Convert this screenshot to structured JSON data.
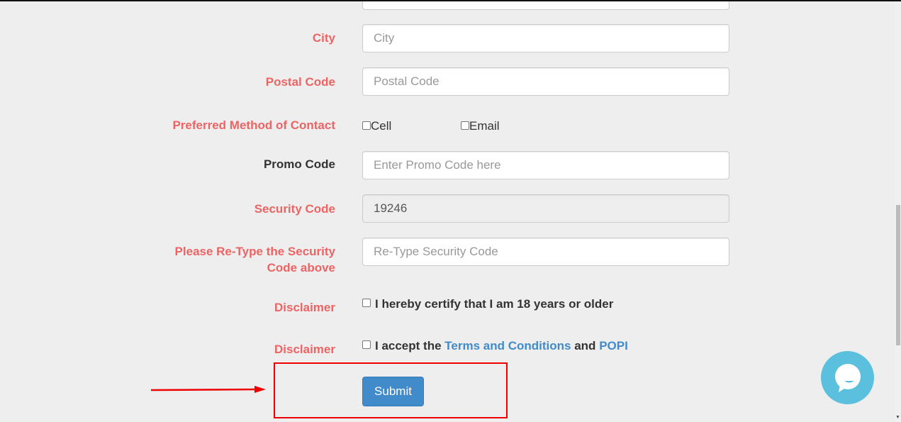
{
  "form": {
    "top_field": {
      "value": ""
    },
    "city": {
      "label": "City",
      "placeholder": "City",
      "value": ""
    },
    "postal_code": {
      "label": "Postal Code",
      "placeholder": "Postal Code",
      "value": ""
    },
    "contact_method": {
      "label": "Preferred Method of Contact",
      "options": [
        {
          "label": "Cell",
          "checked": false
        },
        {
          "label": "Email",
          "checked": false
        }
      ]
    },
    "promo_code": {
      "label": "Promo Code",
      "placeholder": "Enter Promo Code here",
      "value": ""
    },
    "security_code": {
      "label": "Security Code",
      "value": "19246"
    },
    "retype_security": {
      "label_line1": "Please Re-Type the Security",
      "label_line2": "Code above",
      "placeholder": "Re-Type Security Code",
      "value": ""
    },
    "disclaimer_age": {
      "label": "Disclaimer",
      "text": "I hereby certify that I am 18 years or older",
      "checked": false
    },
    "disclaimer_terms": {
      "label": "Disclaimer",
      "text_prefix": "I accept the",
      "terms_link": "Terms and Conditions",
      "text_mid": "and",
      "popi_link": "POPI",
      "checked": false
    },
    "submit_label": "Submit"
  },
  "annotation": {
    "color": "#ee0000"
  },
  "chat_widget": {
    "icon": "chat-bubble-icon",
    "color": "#5bc0de"
  },
  "colors": {
    "required_label": "#ec6464",
    "link": "#428bca",
    "button": "#428bca"
  }
}
